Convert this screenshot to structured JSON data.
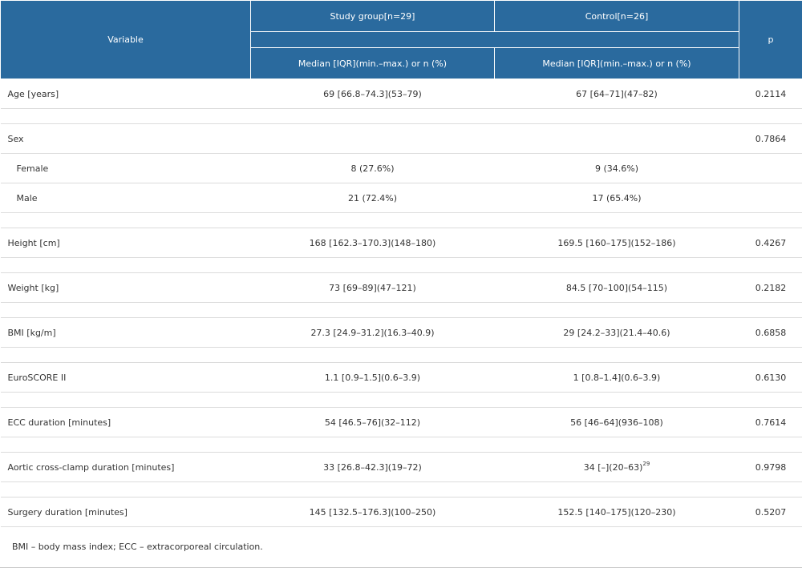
{
  "header": {
    "variable": "Variable",
    "study_group": "Study group[n=29]",
    "control": "Control[n=26]",
    "p": "p",
    "study_sub": "Median [IQR](min.–max.) or n (%)",
    "control_sub": "Median [IQR](min.–max.) or n (%)"
  },
  "rows": [
    {
      "label": "Age [years]",
      "study": "69 [66.8–74.3](53–79)",
      "control": "67 [64–71](47–82)",
      "p": "0.2114"
    },
    {
      "label": "Sex",
      "study": "",
      "control": "",
      "p": "0.7864"
    },
    {
      "label": "Female",
      "study": "8 (27.6%)",
      "control": "9 (34.6%)",
      "p": ""
    },
    {
      "label": "Male",
      "study": "21 (72.4%)",
      "control": "17 (65.4%)",
      "p": ""
    },
    {
      "label": "Height [cm]",
      "study": "168 [162.3–170.3](148–180)",
      "control": "169.5 [160–175](152–186)",
      "p": "0.4267"
    },
    {
      "label": "Weight [kg]",
      "study": "73 [69–89](47–121)",
      "control": "84.5 [70–100](54–115)",
      "p": "0.2182"
    },
    {
      "label": "BMI [kg/m]",
      "study": "27.3 [24.9–31.2](16.3–40.9)",
      "control": "29 [24.2–33](21.4–40.6)",
      "p": "0.6858"
    },
    {
      "label": "EuroSCORE II",
      "study": "1.1 [0.9–1.5](0.6–3.9)",
      "control": "1 [0.8–1.4](0.6–3.9)",
      "p": "0.6130"
    },
    {
      "label": "ECC duration [minutes]",
      "study": "54 [46.5–76](32–112)",
      "control": "56 [46–64](936–108)",
      "p": "0.7614"
    },
    {
      "label": "Aortic cross-clamp duration [minutes]",
      "study": "33 [26.8–42.3](19–72)",
      "control": "34 [–](20–63)",
      "control_sup": "29",
      "p": "0.9798"
    },
    {
      "label": "Surgery duration [minutes]",
      "study": "145 [132.5–176.3](100–250)",
      "control": "152.5 [140–175](120–230)",
      "p": "0.5207"
    }
  ],
  "footnote": "BMI – body mass index; ECC – extracorporeal circulation."
}
